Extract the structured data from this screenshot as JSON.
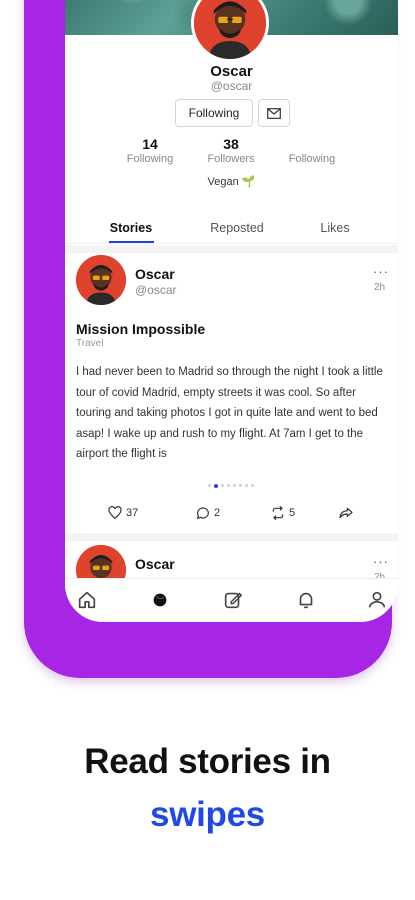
{
  "profile": {
    "name": "Oscar",
    "handle": "@oscar",
    "follow_button_label": "Following",
    "stats": [
      {
        "value": "14",
        "label": "Following"
      },
      {
        "value": "38",
        "label": "Followers"
      },
      {
        "value": "",
        "label": "Following"
      }
    ],
    "tag": "Vegan"
  },
  "tabs": [
    {
      "label": "Stories",
      "active": true
    },
    {
      "label": "Reposted",
      "active": false
    },
    {
      "label": "Likes",
      "active": false
    }
  ],
  "post": {
    "author": "Oscar",
    "handle": "@oscar",
    "time": "2h",
    "title": "Mission Impossible",
    "category": "Travel",
    "body": "I had never been to Madrid so through the night I took a little tour of covid Madrid, empty streets it was cool. So after touring and taking photos I got in quite late and went to bed asap! I wake up and rush to my flight. At 7am I get to the airport the flight is",
    "likes": "37",
    "comments": "2",
    "reposts": "5",
    "pages": 8,
    "current_page": 1
  },
  "next_post": {
    "author": "Oscar",
    "time": "2h"
  },
  "nav": {
    "items": [
      "home-icon",
      "discover-icon",
      "compose-icon",
      "notifications-icon",
      "profile-icon"
    ]
  },
  "headline": {
    "line1": "Read stories in",
    "line2": "swipes"
  },
  "colors": {
    "phone_frame": "#a726e6",
    "accent_blue": "#1f49e6",
    "avatar_bg": "#e0432d"
  }
}
